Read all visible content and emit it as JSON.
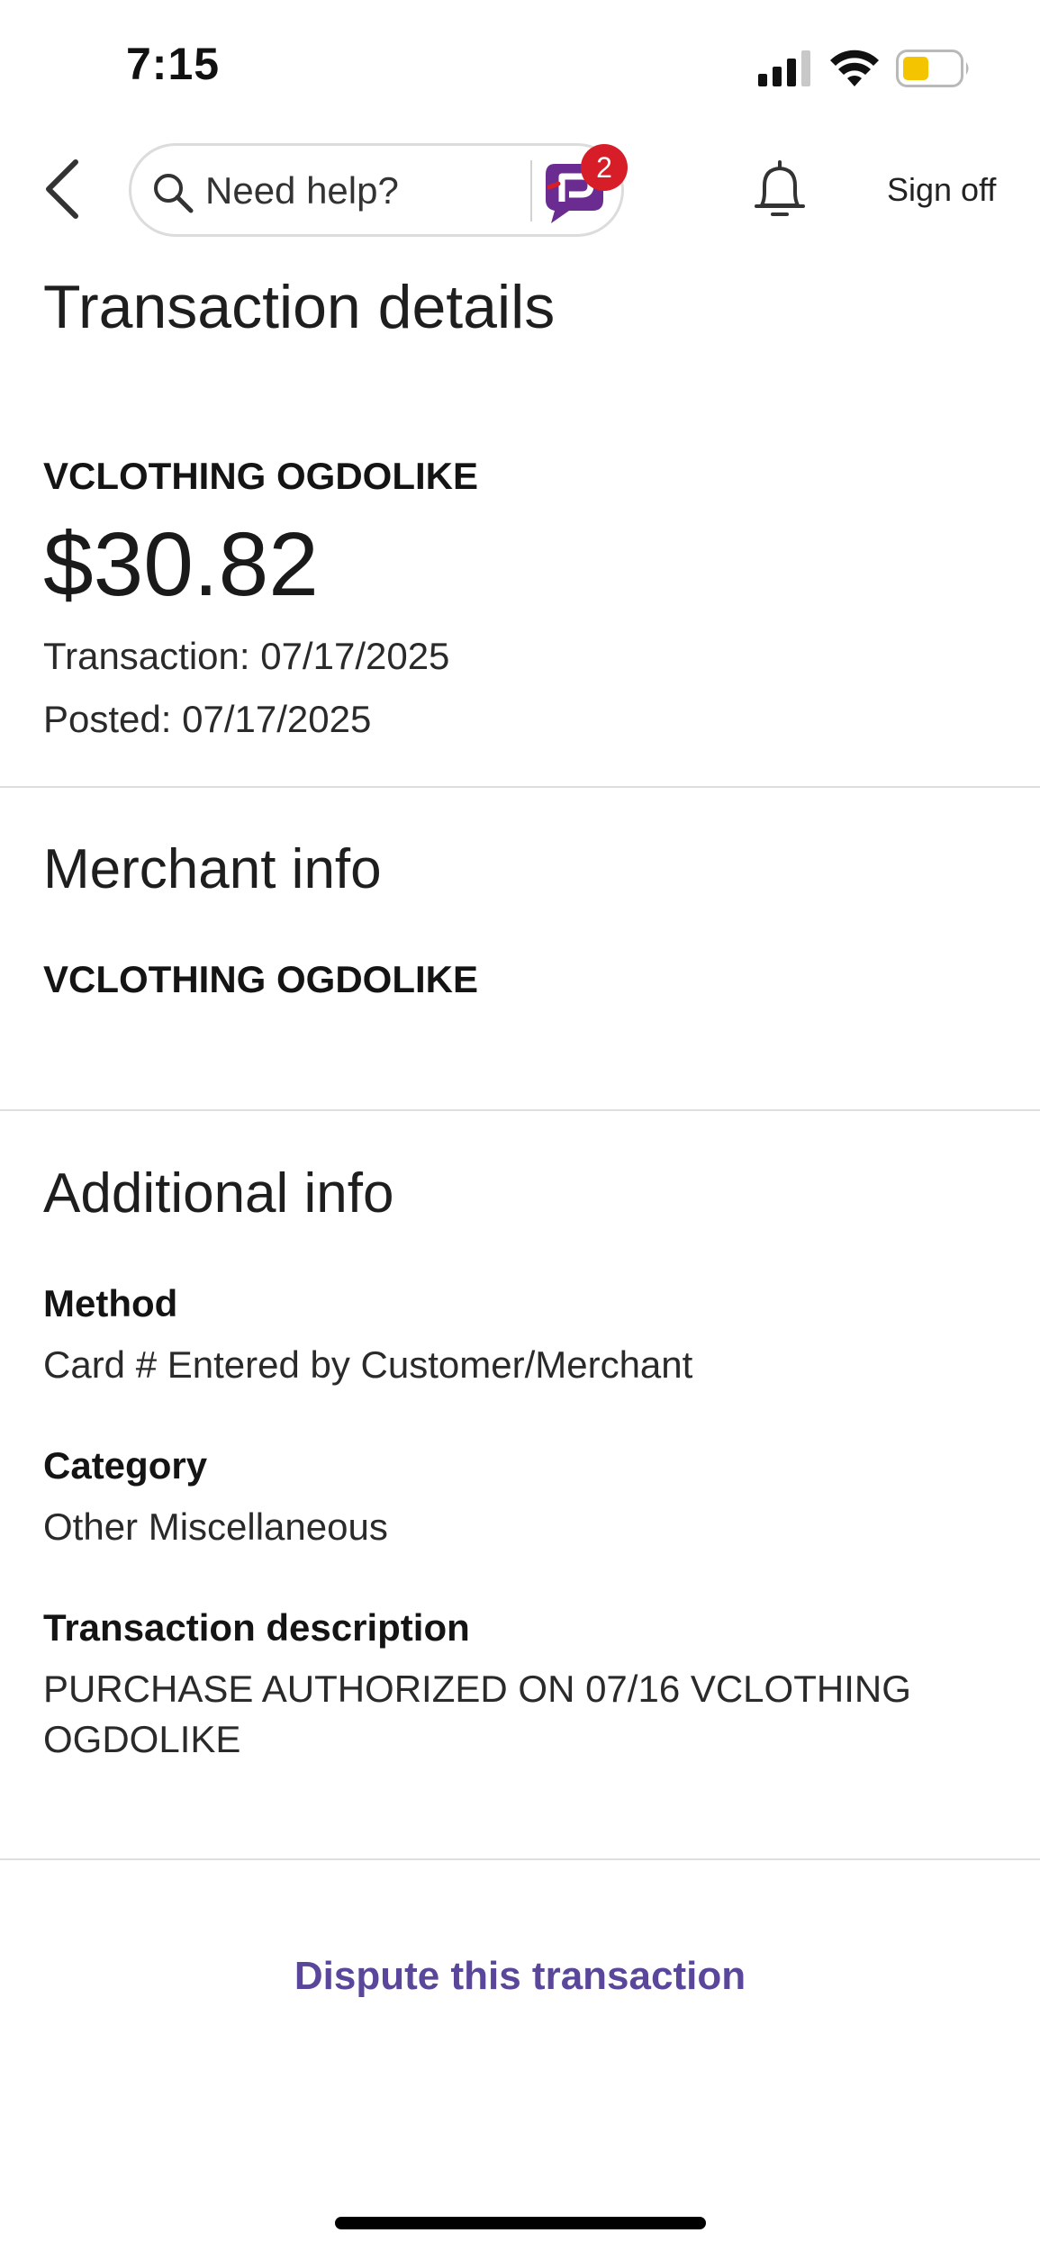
{
  "status_bar": {
    "time": "7:15"
  },
  "nav": {
    "search_placeholder": "Need help?",
    "assistant_badge_count": "2",
    "sign_off_label": "Sign off"
  },
  "page_title": "Transaction details",
  "summary": {
    "merchant": "VCLOTHING OGDOLIKE",
    "amount": "$30.82",
    "transaction_date": "Transaction: 07/17/2025",
    "posted_date": "Posted: 07/17/2025"
  },
  "merchant_info": {
    "heading": "Merchant info",
    "name": "VCLOTHING OGDOLIKE"
  },
  "additional_info": {
    "heading": "Additional info",
    "method_label": "Method",
    "method_value": "Card # Entered by Customer/Merchant",
    "category_label": "Category",
    "category_value": "Other Miscellaneous",
    "description_label": "Transaction description",
    "description_value": "PURCHASE AUTHORIZED ON 07/16 VCLOTHING OGDOLIKE"
  },
  "actions": {
    "dispute_label": "Dispute this transaction"
  },
  "colors": {
    "accent_link": "#5a469b",
    "badge": "#d71e28",
    "assistant_brand": "#6b2c91",
    "battery_fill": "#f5c400"
  },
  "icons": {
    "back": "chevron-left-icon",
    "search": "search-icon",
    "assistant": "assistant-logo-icon",
    "notifications": "bell-icon",
    "signal": "cellular-signal-icon",
    "wifi": "wifi-icon",
    "battery": "battery-icon"
  }
}
